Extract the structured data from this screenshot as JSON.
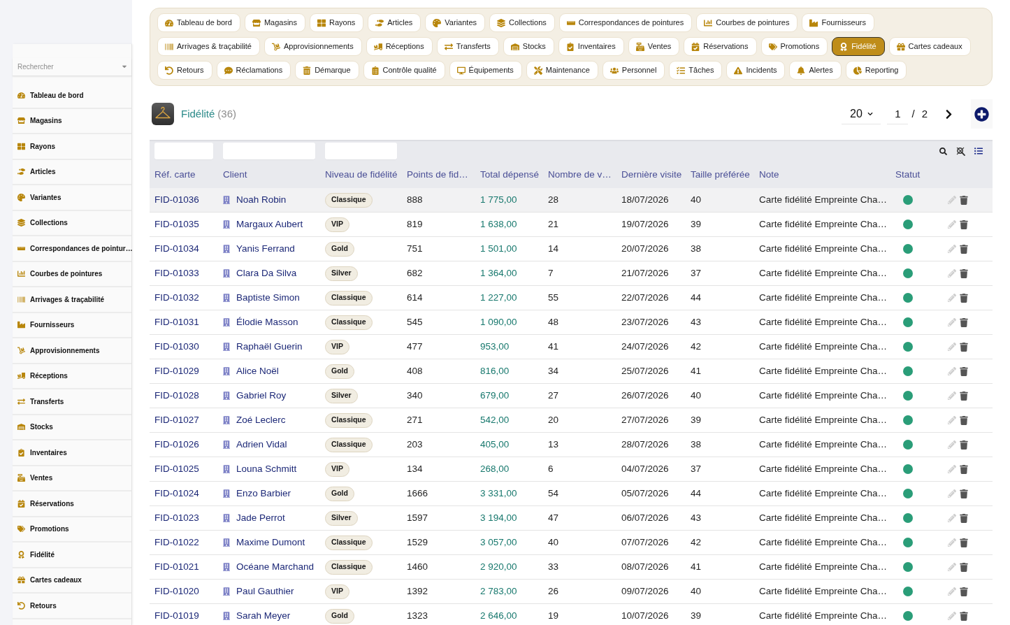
{
  "sidebar": {
    "search": {
      "placeholder": "Rechercher"
    },
    "items": [
      {
        "label": "Tableau de bord"
      },
      {
        "label": "Magasins"
      },
      {
        "label": "Rayons"
      },
      {
        "label": "Articles"
      },
      {
        "label": "Variantes"
      },
      {
        "label": "Collections"
      },
      {
        "label": "Correspondances de pointur…"
      },
      {
        "label": "Courbes de pointures"
      },
      {
        "label": "Arrivages & traçabilité"
      },
      {
        "label": "Fournisseurs"
      },
      {
        "label": "Approvisionnements"
      },
      {
        "label": "Réceptions"
      },
      {
        "label": "Transferts"
      },
      {
        "label": "Stocks"
      },
      {
        "label": "Inventaires"
      },
      {
        "label": "Ventes"
      },
      {
        "label": "Réservations"
      },
      {
        "label": "Promotions"
      },
      {
        "label": "Fidélité"
      },
      {
        "label": "Cartes cadeaux"
      },
      {
        "label": "Retours"
      }
    ]
  },
  "nav": {
    "lines": [
      {
        "tabs": [
          {
            "label": "Tableau de bord",
            "selected": false
          },
          {
            "label": "Magasins",
            "selected": false
          },
          {
            "label": "Rayons",
            "selected": false
          },
          {
            "label": "Articles",
            "selected": false
          },
          {
            "label": "Variantes",
            "selected": false
          },
          {
            "label": "Collections",
            "selected": false
          },
          {
            "label": "Correspondances de pointures",
            "selected": false
          },
          {
            "label": "Courbes de pointures",
            "selected": false
          },
          {
            "label": "Fournisseurs",
            "selected": false
          }
        ]
      },
      {
        "tabs": [
          {
            "label": "Arrivages & traçabilité",
            "selected": false
          },
          {
            "label": "Approvisionnements",
            "selected": false
          },
          {
            "label": "Réceptions",
            "selected": false
          },
          {
            "label": "Transferts",
            "selected": false
          },
          {
            "label": "Stocks",
            "selected": false
          },
          {
            "label": "Inventaires",
            "selected": false
          },
          {
            "label": "Ventes",
            "selected": false
          },
          {
            "label": "Réservations",
            "selected": false
          },
          {
            "label": "Promotions",
            "selected": false
          },
          {
            "label": "Fidélité",
            "selected": true
          },
          {
            "label": "Cartes cadeaux",
            "selected": false
          }
        ]
      },
      {
        "tabs": [
          {
            "label": "Retours",
            "selected": false
          },
          {
            "label": "Réclamations",
            "selected": false
          },
          {
            "label": "Démarque",
            "selected": false
          },
          {
            "label": "Contrôle qualité",
            "selected": false
          },
          {
            "label": "Équipements",
            "selected": false
          },
          {
            "label": "Maintenance",
            "selected": false
          },
          {
            "label": "Personnel",
            "selected": false
          },
          {
            "label": "Tâches",
            "selected": false
          },
          {
            "label": "Incidents",
            "selected": false
          },
          {
            "label": "Alertes",
            "selected": false
          },
          {
            "label": "Reporting",
            "selected": false
          }
        ]
      }
    ]
  },
  "page": {
    "title": "Fidélité",
    "count": "(36)"
  },
  "pagination": {
    "page_size": "20",
    "page": "1",
    "separator": "/",
    "total_pages": "2"
  },
  "table": {
    "columns": [
      {
        "label": "Réf. carte",
        "filter": true
      },
      {
        "label": "Client",
        "filter": true
      },
      {
        "label": "Niveau de fidélité",
        "filter": true
      },
      {
        "label": "Points de fid…",
        "filter": false
      },
      {
        "label": "Total dépensé",
        "filter": false
      },
      {
        "label": "Nombre de v…",
        "filter": false
      },
      {
        "label": "Dernière visite",
        "filter": false
      },
      {
        "label": "Taille préférée",
        "filter": false
      },
      {
        "label": "Note",
        "filter": false
      },
      {
        "label": "Statut",
        "filter": false
      }
    ],
    "rows": [
      {
        "ref": "FID-01036",
        "client": "Noah Robin",
        "level": "Classique",
        "points": "888",
        "total": "1 775,00",
        "visits": "28",
        "last_visit": "18/07/2026",
        "size": "40",
        "note": "Carte fidélité Empreinte Cha…",
        "color": "#2a9d78",
        "highlighted": true
      },
      {
        "ref": "FID-01035",
        "client": "Margaux Aubert",
        "level": "VIP",
        "points": "819",
        "total": "1 638,00",
        "visits": "21",
        "last_visit": "19/07/2026",
        "size": "39",
        "note": "Carte fidélité Empreinte Cha…",
        "color": "#2a9d78",
        "highlighted": false
      },
      {
        "ref": "FID-01034",
        "client": "Yanis Ferrand",
        "level": "Gold",
        "points": "751",
        "total": "1 501,00",
        "visits": "14",
        "last_visit": "20/07/2026",
        "size": "38",
        "note": "Carte fidélité Empreinte Cha…",
        "color": "#2a9d78",
        "highlighted": false
      },
      {
        "ref": "FID-01033",
        "client": "Clara Da Silva",
        "level": "Silver",
        "points": "682",
        "total": "1 364,00",
        "visits": "7",
        "last_visit": "21/07/2026",
        "size": "37",
        "note": "Carte fidélité Empreinte Cha…",
        "color": "#2a9d78",
        "highlighted": false
      },
      {
        "ref": "FID-01032",
        "client": "Baptiste Simon",
        "level": "Classique",
        "points": "614",
        "total": "1 227,00",
        "visits": "55",
        "last_visit": "22/07/2026",
        "size": "44",
        "note": "Carte fidélité Empreinte Cha…",
        "color": "#2a9d78",
        "highlighted": false
      },
      {
        "ref": "FID-01031",
        "client": "Élodie Masson",
        "level": "Classique",
        "points": "545",
        "total": "1 090,00",
        "visits": "48",
        "last_visit": "23/07/2026",
        "size": "43",
        "note": "Carte fidélité Empreinte Cha…",
        "color": "#2a9d78",
        "highlighted": false
      },
      {
        "ref": "FID-01030",
        "client": "Raphaël Guerin",
        "level": "VIP",
        "points": "477",
        "total": "953,00",
        "visits": "41",
        "last_visit": "24/07/2026",
        "size": "42",
        "note": "Carte fidélité Empreinte Cha…",
        "color": "#2a9d78",
        "highlighted": false
      },
      {
        "ref": "FID-01029",
        "client": "Alice Noël",
        "level": "Gold",
        "points": "408",
        "total": "816,00",
        "visits": "34",
        "last_visit": "25/07/2026",
        "size": "41",
        "note": "Carte fidélité Empreinte Cha…",
        "color": "#2a9d78",
        "highlighted": false
      },
      {
        "ref": "FID-01028",
        "client": "Gabriel Roy",
        "level": "Silver",
        "points": "340",
        "total": "679,00",
        "visits": "27",
        "last_visit": "26/07/2026",
        "size": "40",
        "note": "Carte fidélité Empreinte Cha…",
        "color": "#2a9d78",
        "highlighted": false
      },
      {
        "ref": "FID-01027",
        "client": "Zoé Leclerc",
        "level": "Classique",
        "points": "271",
        "total": "542,00",
        "visits": "20",
        "last_visit": "27/07/2026",
        "size": "39",
        "note": "Carte fidélité Empreinte Cha…",
        "color": "#2a9d78",
        "highlighted": false
      },
      {
        "ref": "FID-01026",
        "client": "Adrien Vidal",
        "level": "Classique",
        "points": "203",
        "total": "405,00",
        "visits": "13",
        "last_visit": "28/07/2026",
        "size": "38",
        "note": "Carte fidélité Empreinte Cha…",
        "color": "#2a9d78",
        "highlighted": false
      },
      {
        "ref": "FID-01025",
        "client": "Louna Schmitt",
        "level": "VIP",
        "points": "134",
        "total": "268,00",
        "visits": "6",
        "last_visit": "04/07/2026",
        "size": "37",
        "note": "Carte fidélité Empreinte Cha…",
        "color": "#2a9d78",
        "highlighted": false
      },
      {
        "ref": "FID-01024",
        "client": "Enzo Barbier",
        "level": "Gold",
        "points": "1666",
        "total": "3 331,00",
        "visits": "54",
        "last_visit": "05/07/2026",
        "size": "44",
        "note": "Carte fidélité Empreinte Cha…",
        "color": "#2a9d78",
        "highlighted": false
      },
      {
        "ref": "FID-01023",
        "client": "Jade Perrot",
        "level": "Silver",
        "points": "1597",
        "total": "3 194,00",
        "visits": "47",
        "last_visit": "06/07/2026",
        "size": "43",
        "note": "Carte fidélité Empreinte Cha…",
        "color": "#2a9d78",
        "highlighted": false
      },
      {
        "ref": "FID-01022",
        "client": "Maxime Dumont",
        "level": "Classique",
        "points": "1529",
        "total": "3 057,00",
        "visits": "40",
        "last_visit": "07/07/2026",
        "size": "42",
        "note": "Carte fidélité Empreinte Cha…",
        "color": "#2a9d78",
        "highlighted": false
      },
      {
        "ref": "FID-01021",
        "client": "Océane Marchand",
        "level": "Classique",
        "points": "1460",
        "total": "2 920,00",
        "visits": "33",
        "last_visit": "08/07/2026",
        "size": "41",
        "note": "Carte fidélité Empreinte Cha…",
        "color": "#2a9d78",
        "highlighted": false
      },
      {
        "ref": "FID-01020",
        "client": "Paul Gauthier",
        "level": "VIP",
        "points": "1392",
        "total": "2 783,00",
        "visits": "26",
        "last_visit": "09/07/2026",
        "size": "40",
        "note": "Carte fidélité Empreinte Cha…",
        "color": "#2a9d78",
        "highlighted": false
      },
      {
        "ref": "FID-01019",
        "client": "Sarah Meyer",
        "level": "Gold",
        "points": "1323",
        "total": "2 646,00",
        "visits": "19",
        "last_visit": "10/07/2026",
        "size": "39",
        "note": "Carte fidélité Empreinte Cha…",
        "color": "#2a9d78",
        "highlighted": false
      }
    ]
  }
}
